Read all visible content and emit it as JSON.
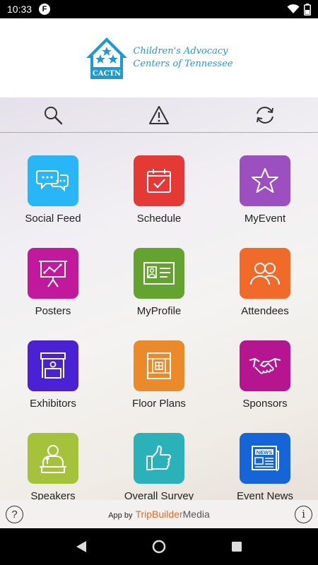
{
  "status_bar": {
    "time": "10:33",
    "notification_badge": "F"
  },
  "header": {
    "logo_abbrev": "CACTN",
    "logo_line1": "Children's Advocacy",
    "logo_line2": "Centers of Tennessee",
    "brand_color": "#1d9ad6"
  },
  "toolbar": {
    "icons": [
      "search-icon",
      "alert-icon",
      "sync-icon"
    ]
  },
  "tiles": [
    {
      "label": "Social Feed",
      "icon": "chat-bubbles-icon",
      "color": "#29b6f6"
    },
    {
      "label": "Schedule",
      "icon": "calendar-icon",
      "color": "#e53935"
    },
    {
      "label": "MyEvent",
      "icon": "star-icon",
      "color": "#9c4fbf"
    },
    {
      "label": "Posters",
      "icon": "presentation-board-icon",
      "color": "#c2189c"
    },
    {
      "label": "MyProfile",
      "icon": "id-card-icon",
      "color": "#65a331"
    },
    {
      "label": "Attendees",
      "icon": "people-icon",
      "color": "#f06a2a"
    },
    {
      "label": "Exhibitors",
      "icon": "exhibitor-booth-icon",
      "color": "#4b21d4"
    },
    {
      "label": "Floor Plans",
      "icon": "floor-plan-icon",
      "color": "#ea8a2a"
    },
    {
      "label": "Sponsors",
      "icon": "handshake-icon",
      "color": "#b5158e"
    },
    {
      "label": "Speakers",
      "icon": "speaker-icon",
      "color": "#a4c23a"
    },
    {
      "label": "Overall Survey",
      "icon": "thumbs-up-icon",
      "color": "#2bb2b8"
    },
    {
      "label": "Event News",
      "icon": "newspaper-icon",
      "color": "#1565d8"
    }
  ],
  "footer": {
    "app_by": "App by",
    "brand_part1": "TripBuilder",
    "brand_part2": "Media",
    "help_glyph": "?",
    "info_glyph": "i"
  }
}
